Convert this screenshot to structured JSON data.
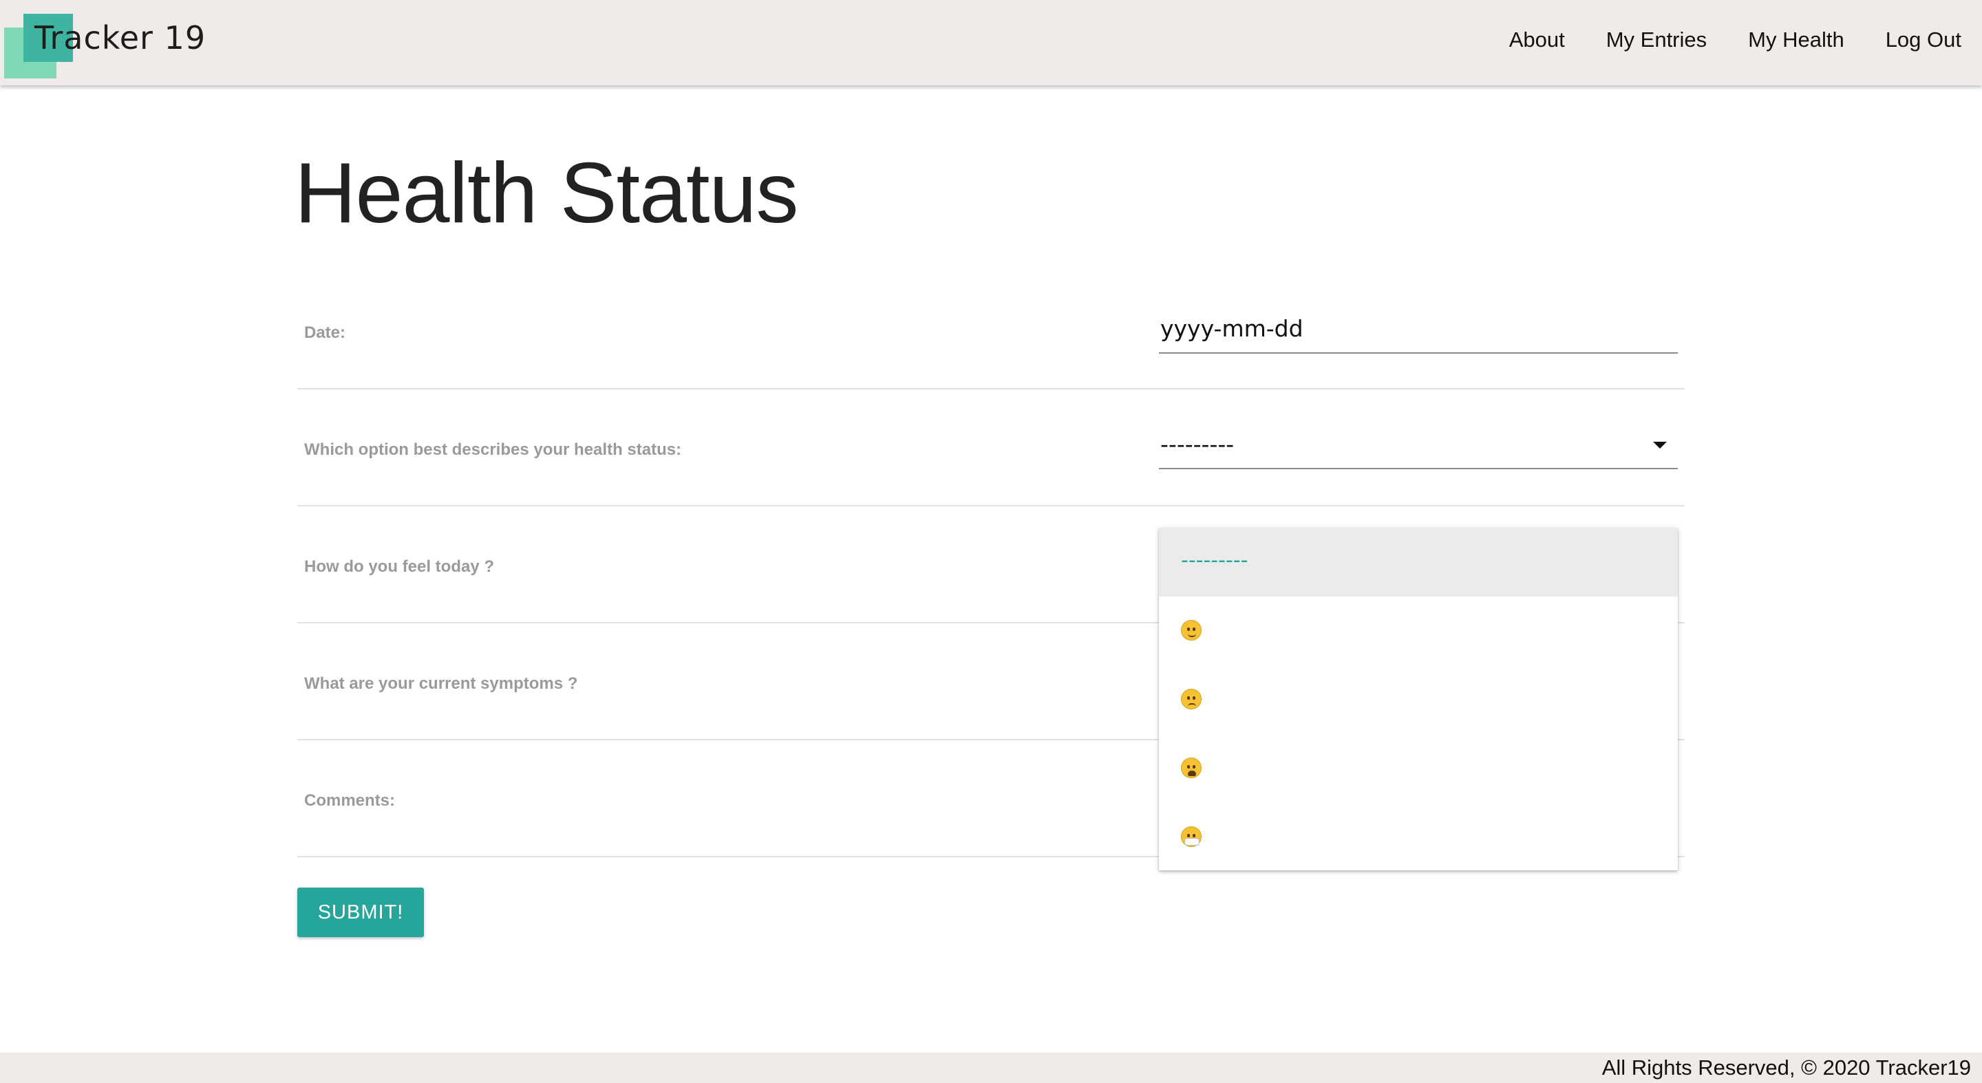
{
  "navbar": {
    "brand": "Tracker 19",
    "links": [
      "About",
      "My Entries",
      "My Health",
      "Log Out"
    ]
  },
  "page": {
    "title": "Health Status"
  },
  "form": {
    "date_label": "Date:",
    "date_placeholder": "yyyy-mm-dd",
    "status_label": "Which option best describes your health status:",
    "status_selected": "---------",
    "feel_label": "How do you feel today ?",
    "symptoms_label": "What are your current symptoms ?",
    "comments_label": "Comments:",
    "submit_label": "SUBMIT!"
  },
  "dropdown": {
    "options": [
      {
        "label": "---------",
        "icon": "",
        "selected": true
      },
      {
        "label": "",
        "icon": "relieved-face-emoji-icon",
        "selected": false
      },
      {
        "label": "",
        "icon": "slightly-frowning-face-emoji-icon",
        "selected": false
      },
      {
        "label": "",
        "icon": "tired-face-emoji-icon",
        "selected": false
      },
      {
        "label": "",
        "icon": "face-with-medical-mask-emoji-icon",
        "selected": false
      }
    ]
  },
  "footer": {
    "text": "All Rights Reserved, © 2020 Tracker19"
  },
  "colors": {
    "accent": "#26a69a",
    "navbar_bg": "#f0ebe8",
    "logo_light": "#80d9b6",
    "logo_dark": "#3db3a0"
  }
}
